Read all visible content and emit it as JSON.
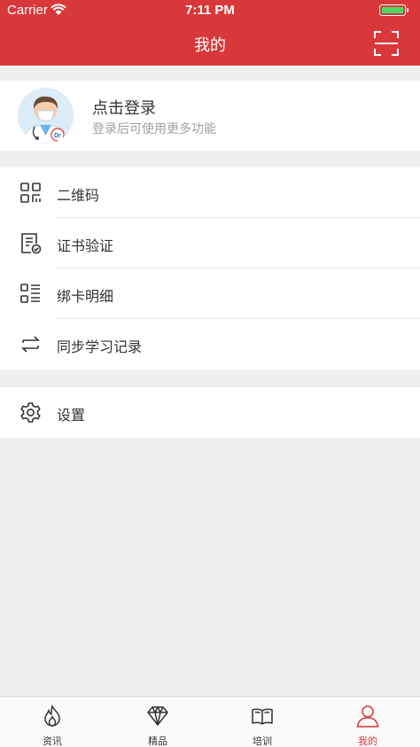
{
  "status_bar": {
    "carrier": "Carrier",
    "time": "7:11 PM",
    "battery_level": 1.0
  },
  "header": {
    "title": "我的"
  },
  "profile": {
    "login_title": "点击登录",
    "login_subtitle": "登录后可使用更多功能"
  },
  "menu": {
    "qr_code": "二维码",
    "cert_verify": "证书验证",
    "card_details": "绑卡明细",
    "sync_records": "同步学习记录",
    "settings": "设置"
  },
  "tabs": [
    {
      "label": "资讯",
      "icon": "flame-icon"
    },
    {
      "label": "精品",
      "icon": "diamond-icon"
    },
    {
      "label": "培训",
      "icon": "book-icon"
    },
    {
      "label": "我的",
      "icon": "person-icon"
    }
  ],
  "colors": {
    "accent": "#d8383a",
    "battery": "#4cd964"
  }
}
